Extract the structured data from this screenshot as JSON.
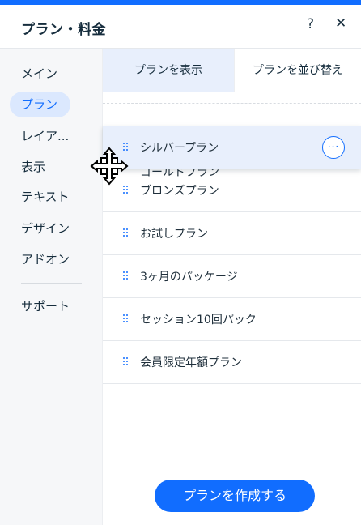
{
  "header": {
    "title": "プラン・料金",
    "help_label": "?",
    "close_label": "✕"
  },
  "sidebar": {
    "items": [
      {
        "label": "メイン"
      },
      {
        "label": "プラン",
        "active": true
      },
      {
        "label": "レイア..."
      },
      {
        "label": "表示"
      },
      {
        "label": "テキスト"
      },
      {
        "label": "デザイン"
      },
      {
        "label": "アドオン"
      },
      {
        "label": "サポート"
      }
    ]
  },
  "tabs": [
    {
      "label": "プランを表示",
      "selected": true
    },
    {
      "label": "プランを並び替え",
      "selected": false
    }
  ],
  "dragging_item": {
    "label": "シルバープラン",
    "more_label": "···"
  },
  "under_item_partial": "ゴールドプラン",
  "plans": [
    {
      "label": "ブロンズプラン"
    },
    {
      "label": "お試しプラン"
    },
    {
      "label": "3ヶ月のパッケージ"
    },
    {
      "label": "セッション10回パック"
    },
    {
      "label": "会員限定年額プラン"
    }
  ],
  "create_button_label": "プランを作成する",
  "colors": {
    "accent": "#116dff",
    "selected_bg": "#e8effc",
    "sidebar_bg": "#f6f7f9"
  },
  "icons": {
    "drag_handle": "drag-handle-icon",
    "more": "more-horizontal-icon",
    "cursor": "move-cursor-icon"
  }
}
